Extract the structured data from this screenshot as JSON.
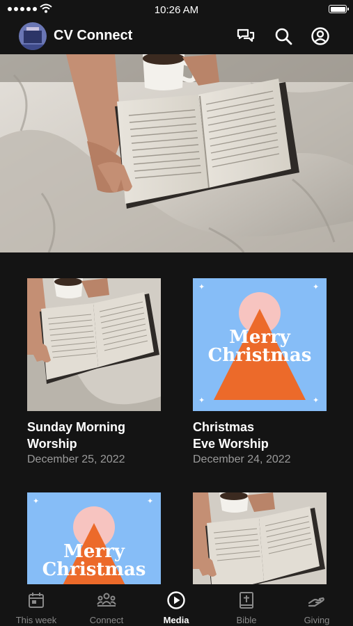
{
  "status_bar": {
    "time": "10:26 AM"
  },
  "app": {
    "title": "CV Connect"
  },
  "header_icons": [
    "chat-icon",
    "search-icon",
    "profile-icon"
  ],
  "media": [
    {
      "title": "Sunday Morning\nWorship",
      "date": "December 25, 2022",
      "thumbnail": "bible-blanket"
    },
    {
      "title": "Christmas\nEve Worship",
      "date": "December 24, 2022",
      "thumbnail": "merry-christmas",
      "thumbnail_text": "Merry\nChristmas"
    },
    {
      "title": "",
      "date": "",
      "thumbnail": "merry-christmas",
      "thumbnail_text": "Merry\nChristmas"
    },
    {
      "title": "",
      "date": "",
      "thumbnail": "bible-blanket"
    }
  ],
  "tabs": [
    {
      "label": "This week",
      "icon": "calendar-icon",
      "active": false
    },
    {
      "label": "Connect",
      "icon": "group-icon",
      "active": false
    },
    {
      "label": "Media",
      "icon": "play-icon",
      "active": true
    },
    {
      "label": "Bible",
      "icon": "bible-icon",
      "active": false
    },
    {
      "label": "Giving",
      "icon": "giving-hand-icon",
      "active": false
    }
  ],
  "colors": {
    "background": "#141414",
    "christmas_sky": "#86bdf7",
    "christmas_tree": "#ec6a2a",
    "christmas_sun": "#f7c4c0",
    "tab_inactive": "#8a8a8a",
    "date_text": "#9b9b9b"
  }
}
